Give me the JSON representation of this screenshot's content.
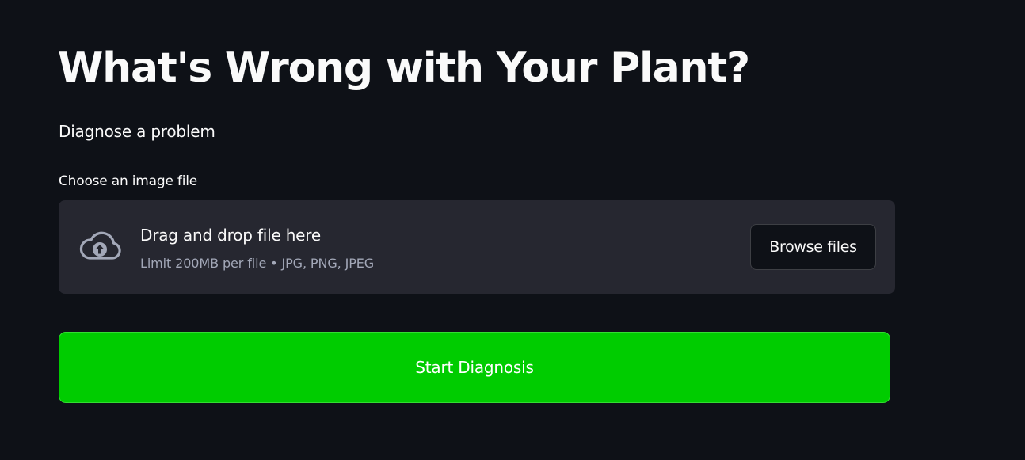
{
  "page": {
    "title": "What's Wrong with Your Plant?",
    "subtitle": "Diagnose a problem"
  },
  "uploader": {
    "label": "Choose an image file",
    "icon": "cloud-upload-icon",
    "instruction": "Drag and drop file here",
    "limits": "Limit 200MB per file • JPG, PNG, JPEG",
    "browse_label": "Browse files"
  },
  "actions": {
    "start_label": "Start Diagnosis"
  },
  "colors": {
    "background": "#0e1117",
    "dropzone": "#262730",
    "primary_button": "#00cc00",
    "text": "#fafafa",
    "muted_text": "#a3a8b8"
  }
}
